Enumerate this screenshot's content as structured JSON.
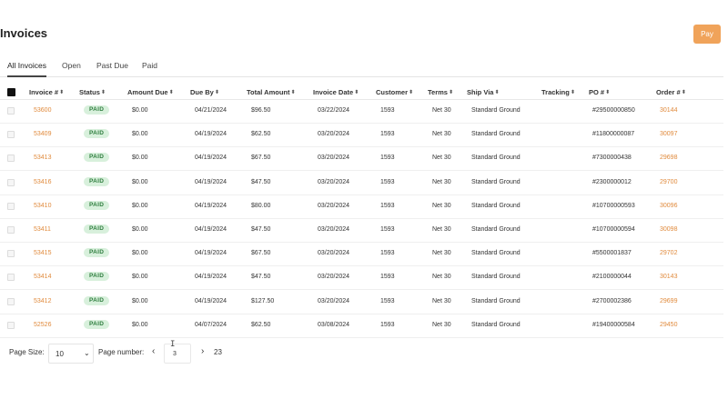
{
  "page": {
    "title": "Invoices"
  },
  "toolbar": {
    "pay_label": "Pay"
  },
  "tabs": [
    {
      "label": "All Invoices",
      "active": true
    },
    {
      "label": "Open",
      "active": false
    },
    {
      "label": "Past Due",
      "active": false
    },
    {
      "label": "Paid",
      "active": false
    }
  ],
  "table": {
    "columns": [
      "Invoice #",
      "Status",
      "Amount Due",
      "Due By",
      "Total Amount",
      "Invoice Date",
      "Customer",
      "Terms",
      "Ship Via",
      "Tracking",
      "PO #",
      "Order #"
    ],
    "rows": [
      {
        "invoice": "53600",
        "status": "PAID",
        "amount_due": "$0.00",
        "due_by": "04/21/2024",
        "total": "$96.50",
        "invoice_date": "03/22/2024",
        "customer": "1593",
        "terms": "Net 30",
        "ship_via": "Standard Ground",
        "tracking": "",
        "po": "#29500000850",
        "order": "30144"
      },
      {
        "invoice": "53409",
        "status": "PAID",
        "amount_due": "$0.00",
        "due_by": "04/19/2024",
        "total": "$62.50",
        "invoice_date": "03/20/2024",
        "customer": "1593",
        "terms": "Net 30",
        "ship_via": "Standard Ground",
        "tracking": "",
        "po": "#11800000087",
        "order": "30097"
      },
      {
        "invoice": "53413",
        "status": "PAID",
        "amount_due": "$0.00",
        "due_by": "04/19/2024",
        "total": "$67.50",
        "invoice_date": "03/20/2024",
        "customer": "1593",
        "terms": "Net 30",
        "ship_via": "Standard Ground",
        "tracking": "",
        "po": "#7300000438",
        "order": "29698"
      },
      {
        "invoice": "53416",
        "status": "PAID",
        "amount_due": "$0.00",
        "due_by": "04/19/2024",
        "total": "$47.50",
        "invoice_date": "03/20/2024",
        "customer": "1593",
        "terms": "Net 30",
        "ship_via": "Standard Ground",
        "tracking": "",
        "po": "#2300000012",
        "order": "29700"
      },
      {
        "invoice": "53410",
        "status": "PAID",
        "amount_due": "$0.00",
        "due_by": "04/19/2024",
        "total": "$80.00",
        "invoice_date": "03/20/2024",
        "customer": "1593",
        "terms": "Net 30",
        "ship_via": "Standard Ground",
        "tracking": "",
        "po": "#10700000593",
        "order": "30096"
      },
      {
        "invoice": "53411",
        "status": "PAID",
        "amount_due": "$0.00",
        "due_by": "04/19/2024",
        "total": "$47.50",
        "invoice_date": "03/20/2024",
        "customer": "1593",
        "terms": "Net 30",
        "ship_via": "Standard Ground",
        "tracking": "",
        "po": "#10700000594",
        "order": "30098"
      },
      {
        "invoice": "53415",
        "status": "PAID",
        "amount_due": "$0.00",
        "due_by": "04/19/2024",
        "total": "$67.50",
        "invoice_date": "03/20/2024",
        "customer": "1593",
        "terms": "Net 30",
        "ship_via": "Standard Ground",
        "tracking": "",
        "po": "#5500001837",
        "order": "29702"
      },
      {
        "invoice": "53414",
        "status": "PAID",
        "amount_due": "$0.00",
        "due_by": "04/19/2024",
        "total": "$47.50",
        "invoice_date": "03/20/2024",
        "customer": "1593",
        "terms": "Net 30",
        "ship_via": "Standard Ground",
        "tracking": "",
        "po": "#2100000044",
        "order": "30143"
      },
      {
        "invoice": "53412",
        "status": "PAID",
        "amount_due": "$0.00",
        "due_by": "04/19/2024",
        "total": "$127.50",
        "invoice_date": "03/20/2024",
        "customer": "1593",
        "terms": "Net 30",
        "ship_via": "Standard Ground",
        "tracking": "",
        "po": "#2700002386",
        "order": "29699"
      },
      {
        "invoice": "52526",
        "status": "PAID",
        "amount_due": "$0.00",
        "due_by": "04/07/2024",
        "total": "$62.50",
        "invoice_date": "03/08/2024",
        "customer": "1593",
        "terms": "Net 30",
        "ship_via": "Standard Ground",
        "tracking": "",
        "po": "#19400000584",
        "order": "29450"
      }
    ]
  },
  "pagination": {
    "page_size_label": "Page Size:",
    "page_size_value": "10",
    "page_number_label": "Page number:",
    "page_number_value": "3",
    "total_pages": "23"
  },
  "icons": {
    "sort": "sort-icon",
    "prev": "chevron-left-icon",
    "next": "chevron-right-icon",
    "dropdown": "chevron-down-icon",
    "cursor": "text-cursor-icon"
  },
  "colors": {
    "accent": "#f0a35a",
    "link": "#e08a3c",
    "badge_bg": "#d8f0dc",
    "badge_text": "#2e7d3e"
  }
}
